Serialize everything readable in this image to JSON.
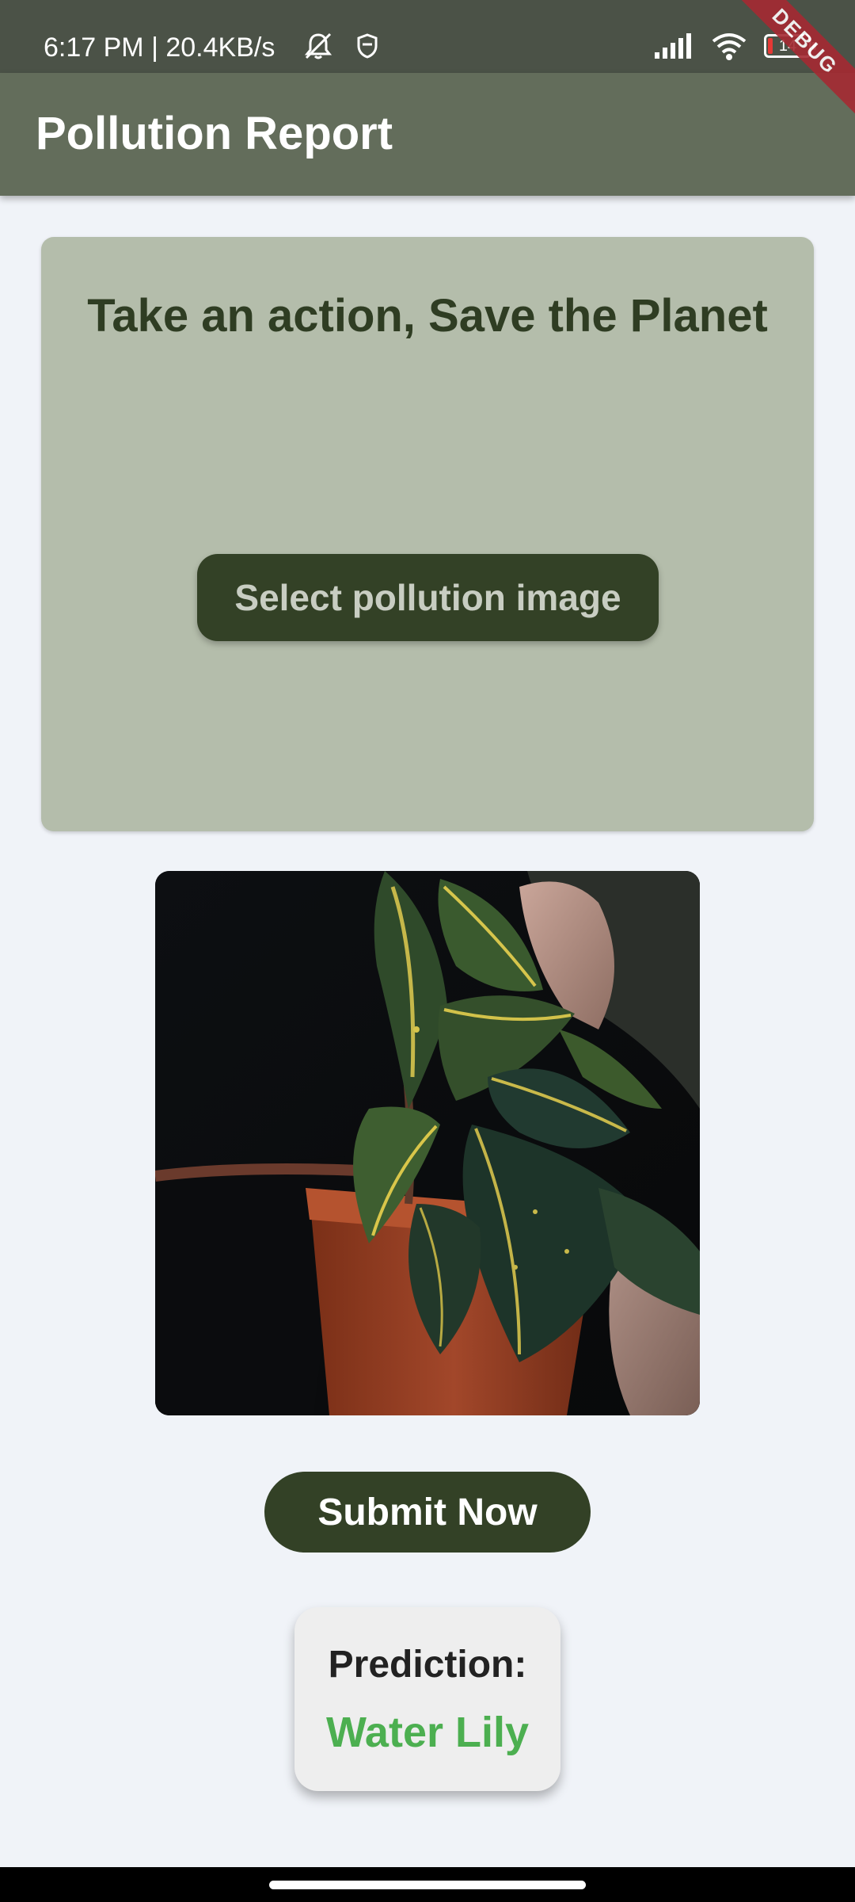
{
  "status_bar": {
    "time_speed": "6:17 PM | 20.4KB/s",
    "battery_level": "14",
    "icons": [
      "mute-alarm-icon",
      "shield-icon",
      "signal-icon",
      "wifi-icon",
      "battery-icon"
    ]
  },
  "debug_banner": "DEBUG",
  "app_bar": {
    "title": "Pollution Report"
  },
  "action_card": {
    "headline": "Take an action, Save the Planet",
    "select_button_label": "Select pollution image"
  },
  "selected_image": {
    "subject": "potted-plant-photo"
  },
  "submit_button_label": "Submit Now",
  "prediction": {
    "label": "Prediction:",
    "value": "Water Lily"
  },
  "colors": {
    "status_bar": "#4b5247",
    "app_bar": "#636d5b",
    "card": "#b4bdab",
    "button": "#334126",
    "background": "#f0f3f8",
    "prediction_value": "#4caf50",
    "debug": "#a52a32"
  }
}
